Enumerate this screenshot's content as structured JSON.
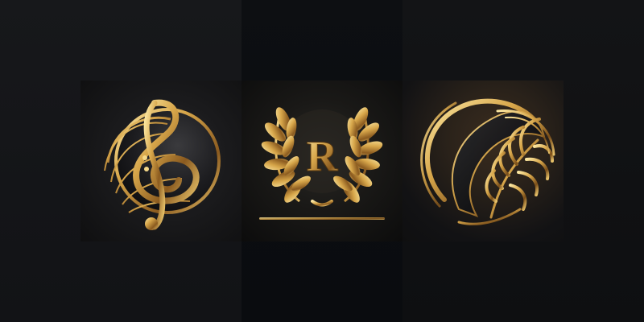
{
  "panels": [
    {
      "id": "treble-clef-emblem"
    },
    {
      "id": "laurel-monogram-emblem",
      "monogram_letter": "R"
    },
    {
      "id": "feather-emblem"
    }
  ],
  "colors": {
    "gold_light": "#f6d989",
    "gold": "#d7a64a",
    "gold_dark": "#7a4e19",
    "black_gloss": "#1a1a1c"
  }
}
